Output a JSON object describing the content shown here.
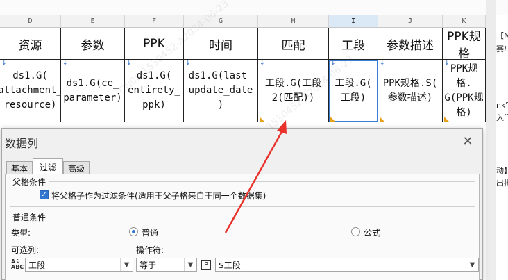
{
  "spreadsheet": {
    "columns": [
      {
        "letter": "D",
        "header": "资源",
        "value": "ds1.G(\nattachment_\nresource)"
      },
      {
        "letter": "E",
        "header": "参数",
        "value": "ds1.G(ce_\nparameter)"
      },
      {
        "letter": "F",
        "header": "PPK",
        "value": "ds1.G(\nentirety_\nppk)"
      },
      {
        "letter": "G",
        "header": "时间",
        "value": "ds1.G(last_\nupdate_date\n)"
      },
      {
        "letter": "H",
        "header": "匹配",
        "value": "工段.G(工段\n2(匹配))"
      },
      {
        "letter": "I",
        "header": "工段",
        "value": "工段.G(\n工段)"
      },
      {
        "letter": "J",
        "header": "参数描述",
        "value": "PPK规格.S(\n参数描述)"
      },
      {
        "letter": "K",
        "header": "PPK规格",
        "value": "PPK规格.\nG(PPK规\n格)"
      }
    ],
    "right_fragments": [
      "【M",
      "赛!",
      "nk字",
      "入门",
      "动】",
      "出播"
    ]
  },
  "dialog": {
    "title": "数据列",
    "close_icon": "close-icon",
    "tabs": [
      {
        "label": "基本",
        "active": false
      },
      {
        "label": "过滤",
        "active": true
      },
      {
        "label": "高级",
        "active": false
      }
    ],
    "parent_group": {
      "title": "父格条件",
      "checkbox_label": "将父格子作为过滤条件(适用于父子格来自于同一个数据集)",
      "checked": true
    },
    "normal_group": {
      "title": "普通条件",
      "type_label": "类型:",
      "radio_normal": "普通",
      "radio_formula": "公式",
      "selected": "普通",
      "available_label": "可选列:",
      "available_value": "工段",
      "operator_label": "操作符:",
      "operator_value": "等于",
      "param_value": "$工段",
      "param_icon_text": "P"
    }
  },
  "colors": {
    "selection_border": "#3b7ed6",
    "checkbox_blue": "#2f77d1",
    "annotation_arrow": "#e8312a",
    "corner_marker": "#e3a21a"
  }
}
